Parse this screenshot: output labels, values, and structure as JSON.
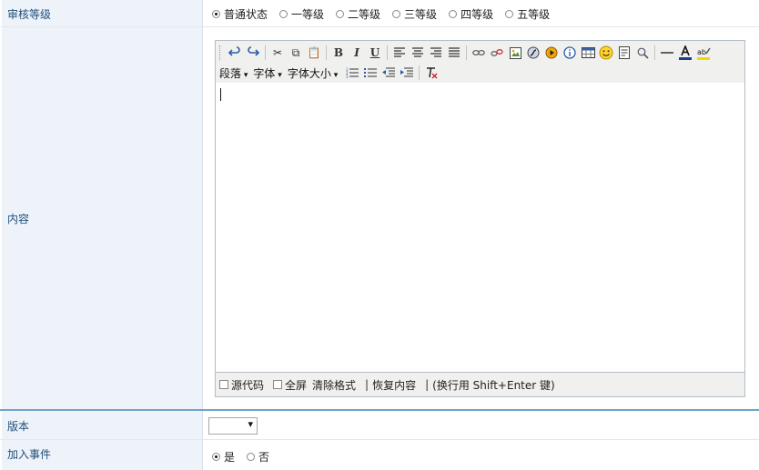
{
  "review_level": {
    "label": "审核等级",
    "options": [
      "普通状态",
      "一等级",
      "二等级",
      "三等级",
      "四等级",
      "五等级"
    ],
    "selected_index": 0
  },
  "content": {
    "label": "内容",
    "toolbar_row1": [
      "undo-icon",
      "redo-icon",
      "|",
      "cut-icon",
      "copy-icon",
      "paste-icon",
      "|",
      "bold-icon",
      "italic-icon",
      "underline-icon",
      "|",
      "align-left-icon",
      "align-center-icon",
      "align-right-icon",
      "align-justify-icon",
      "|",
      "link-icon",
      "unlink-icon",
      "image-icon",
      "flash-icon",
      "media-icon",
      "info-icon",
      "table-icon",
      "emoticon-icon",
      "template-icon",
      "search-icon",
      "|",
      "hr-icon",
      "text-color-icon",
      "bg-color-icon"
    ],
    "dropdowns": [
      "段落",
      "字体",
      "字体大小"
    ],
    "toolbar_row2_icons": [
      "ordered-list-icon",
      "unordered-list-icon",
      "outdent-icon",
      "indent-icon",
      "remove-format-icon"
    ],
    "bold_label": "B",
    "italic_label": "I",
    "underline_label": "U",
    "status": {
      "source_label": "源代码",
      "fullscreen_label": "全屏",
      "clear_format_label": "清除格式",
      "restore_label": "恢复内容",
      "hint": "(换行用 Shift+Enter 键)"
    }
  },
  "version": {
    "label": "版本",
    "selected_value": ""
  },
  "add_event": {
    "label": "加入事件",
    "options": [
      "是",
      "否"
    ],
    "selected_index": 0
  }
}
